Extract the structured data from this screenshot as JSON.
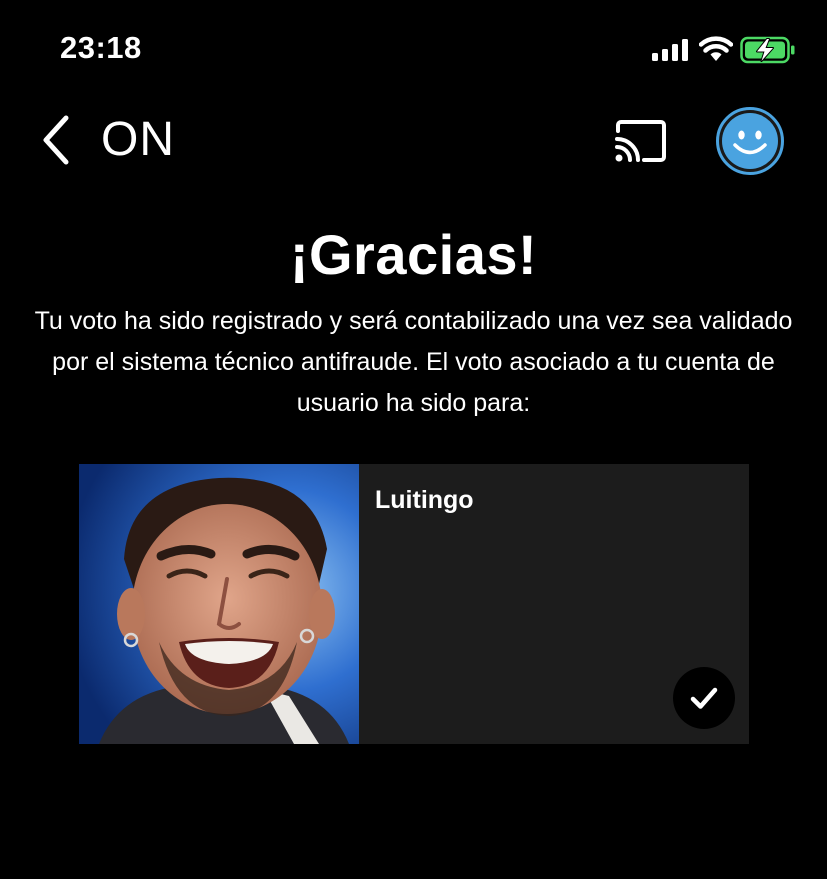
{
  "status_bar": {
    "time": "23:18",
    "icons": [
      "signal-icon",
      "wifi-icon",
      "battery-charging-icon"
    ]
  },
  "nav": {
    "back_icon": "chevron-left-icon",
    "title": "ON",
    "cast_icon": "cast-icon",
    "avatar_icon": "smiley-avatar-icon"
  },
  "main": {
    "heading": "¡Gracias!",
    "message": "Tu voto ha sido registrado y será contabilizado una vez sea validado por el sistema técnico antifraude. El voto asociado a tu cuenta de usuario ha sido para:"
  },
  "vote_card": {
    "candidate_name": "Luitingo",
    "selected_icon": "checkmark-icon",
    "selected": true
  },
  "colors": {
    "background": "#000000",
    "card_background": "#1c1c1c",
    "avatar_accent": "#4aa3e0",
    "battery_green": "#4cd964"
  }
}
